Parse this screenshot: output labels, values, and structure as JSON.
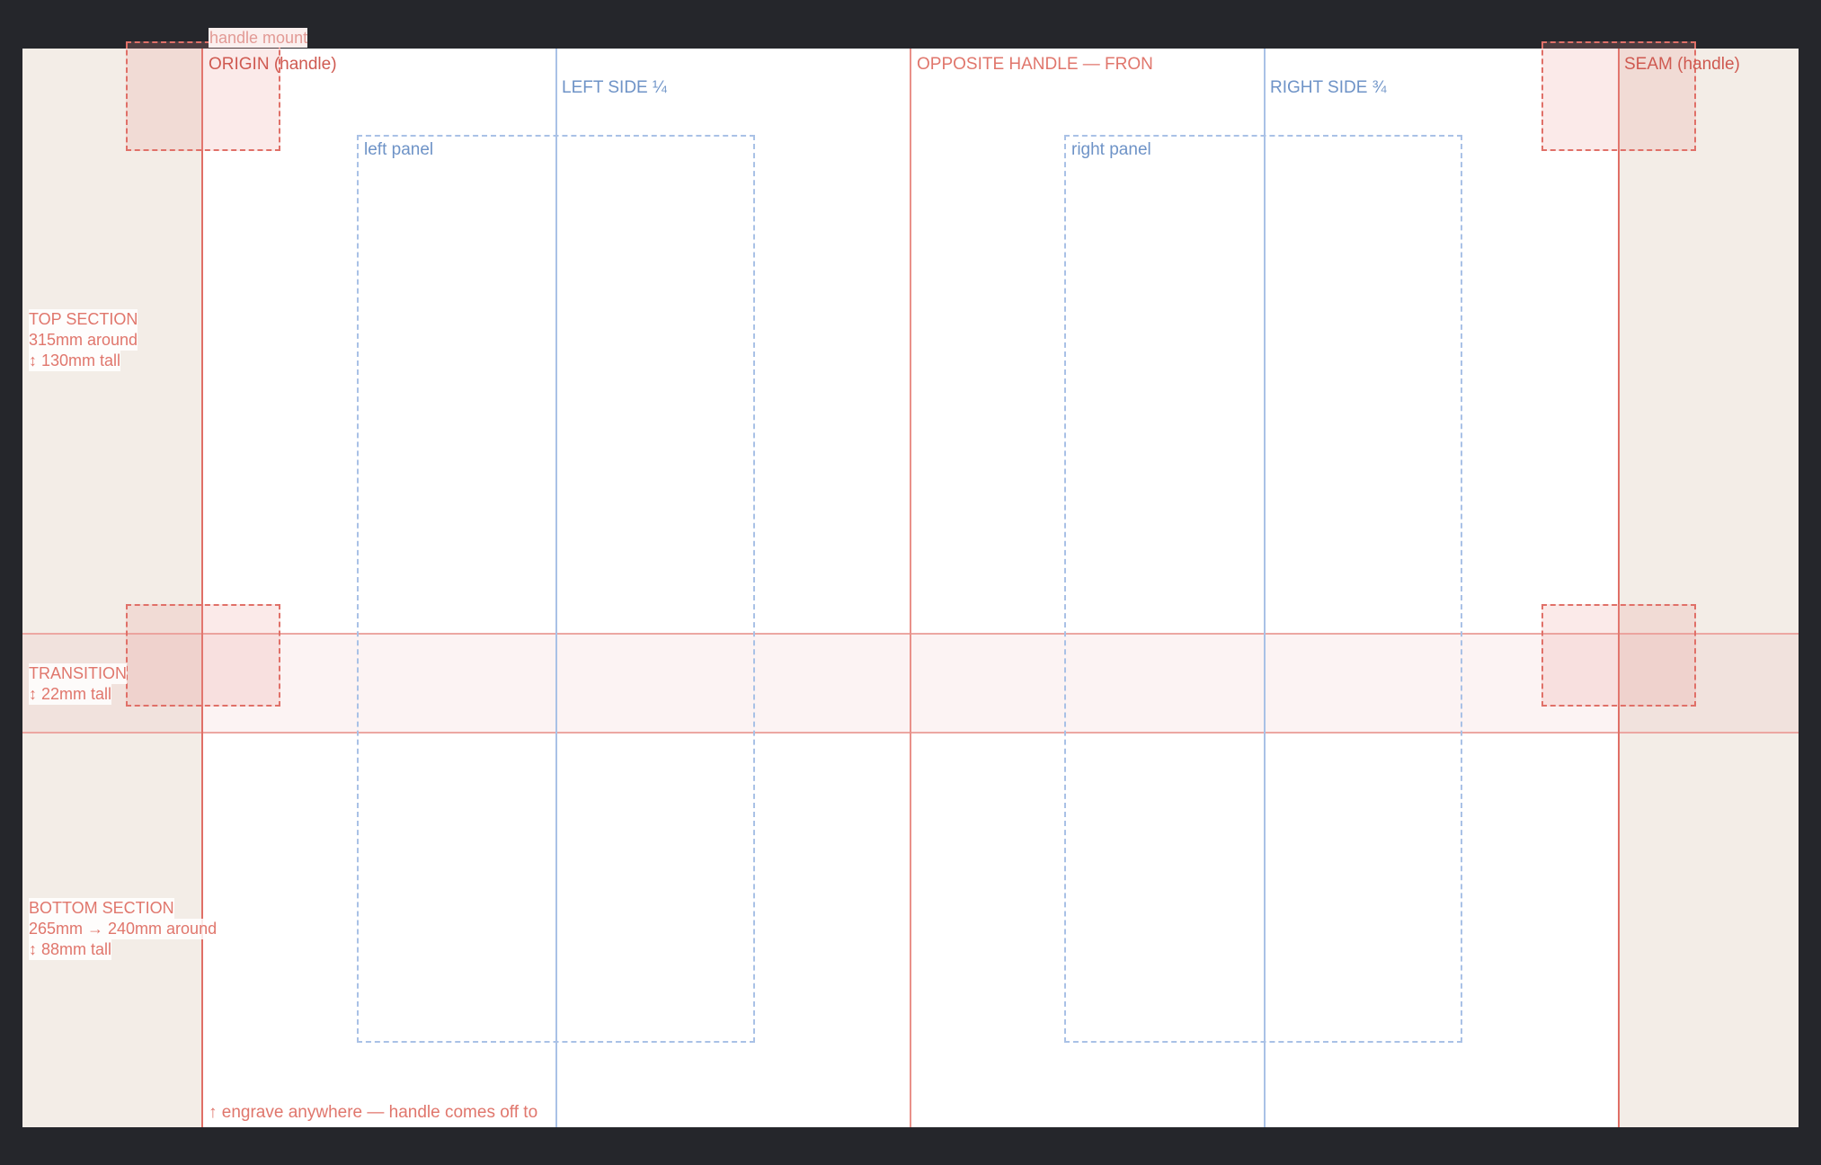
{
  "template": {
    "mount_label": "handle mount",
    "origin_label": "ORIGIN (handle)",
    "left_side_label": "LEFT SIDE ¼",
    "opposite_label": "OPPOSITE HANDLE — FRON",
    "right_side_label": "RIGHT SIDE ¾",
    "seam_label": "SEAM (handle)",
    "left_panel_label": "left panel",
    "right_panel_label": "right panel",
    "engrave_note": "↑ engrave anywhere — handle comes off to"
  },
  "sections": {
    "top": {
      "title": "TOP SECTION",
      "circumference": "315mm around",
      "height": "↕ 130mm tall"
    },
    "transition": {
      "title": "TRANSITION",
      "height": "↕ 22mm tall"
    },
    "bottom": {
      "title": "BOTTOM SECTION",
      "circumference": "265mm → 240mm around",
      "height": "↕ 88mm tall"
    }
  },
  "colors": {
    "background": "#25262b",
    "canvas": "#ffffff",
    "margin_fill": "#f3ede7",
    "guide_red": "#e06f66",
    "guide_blue": "#a9c1e6"
  }
}
